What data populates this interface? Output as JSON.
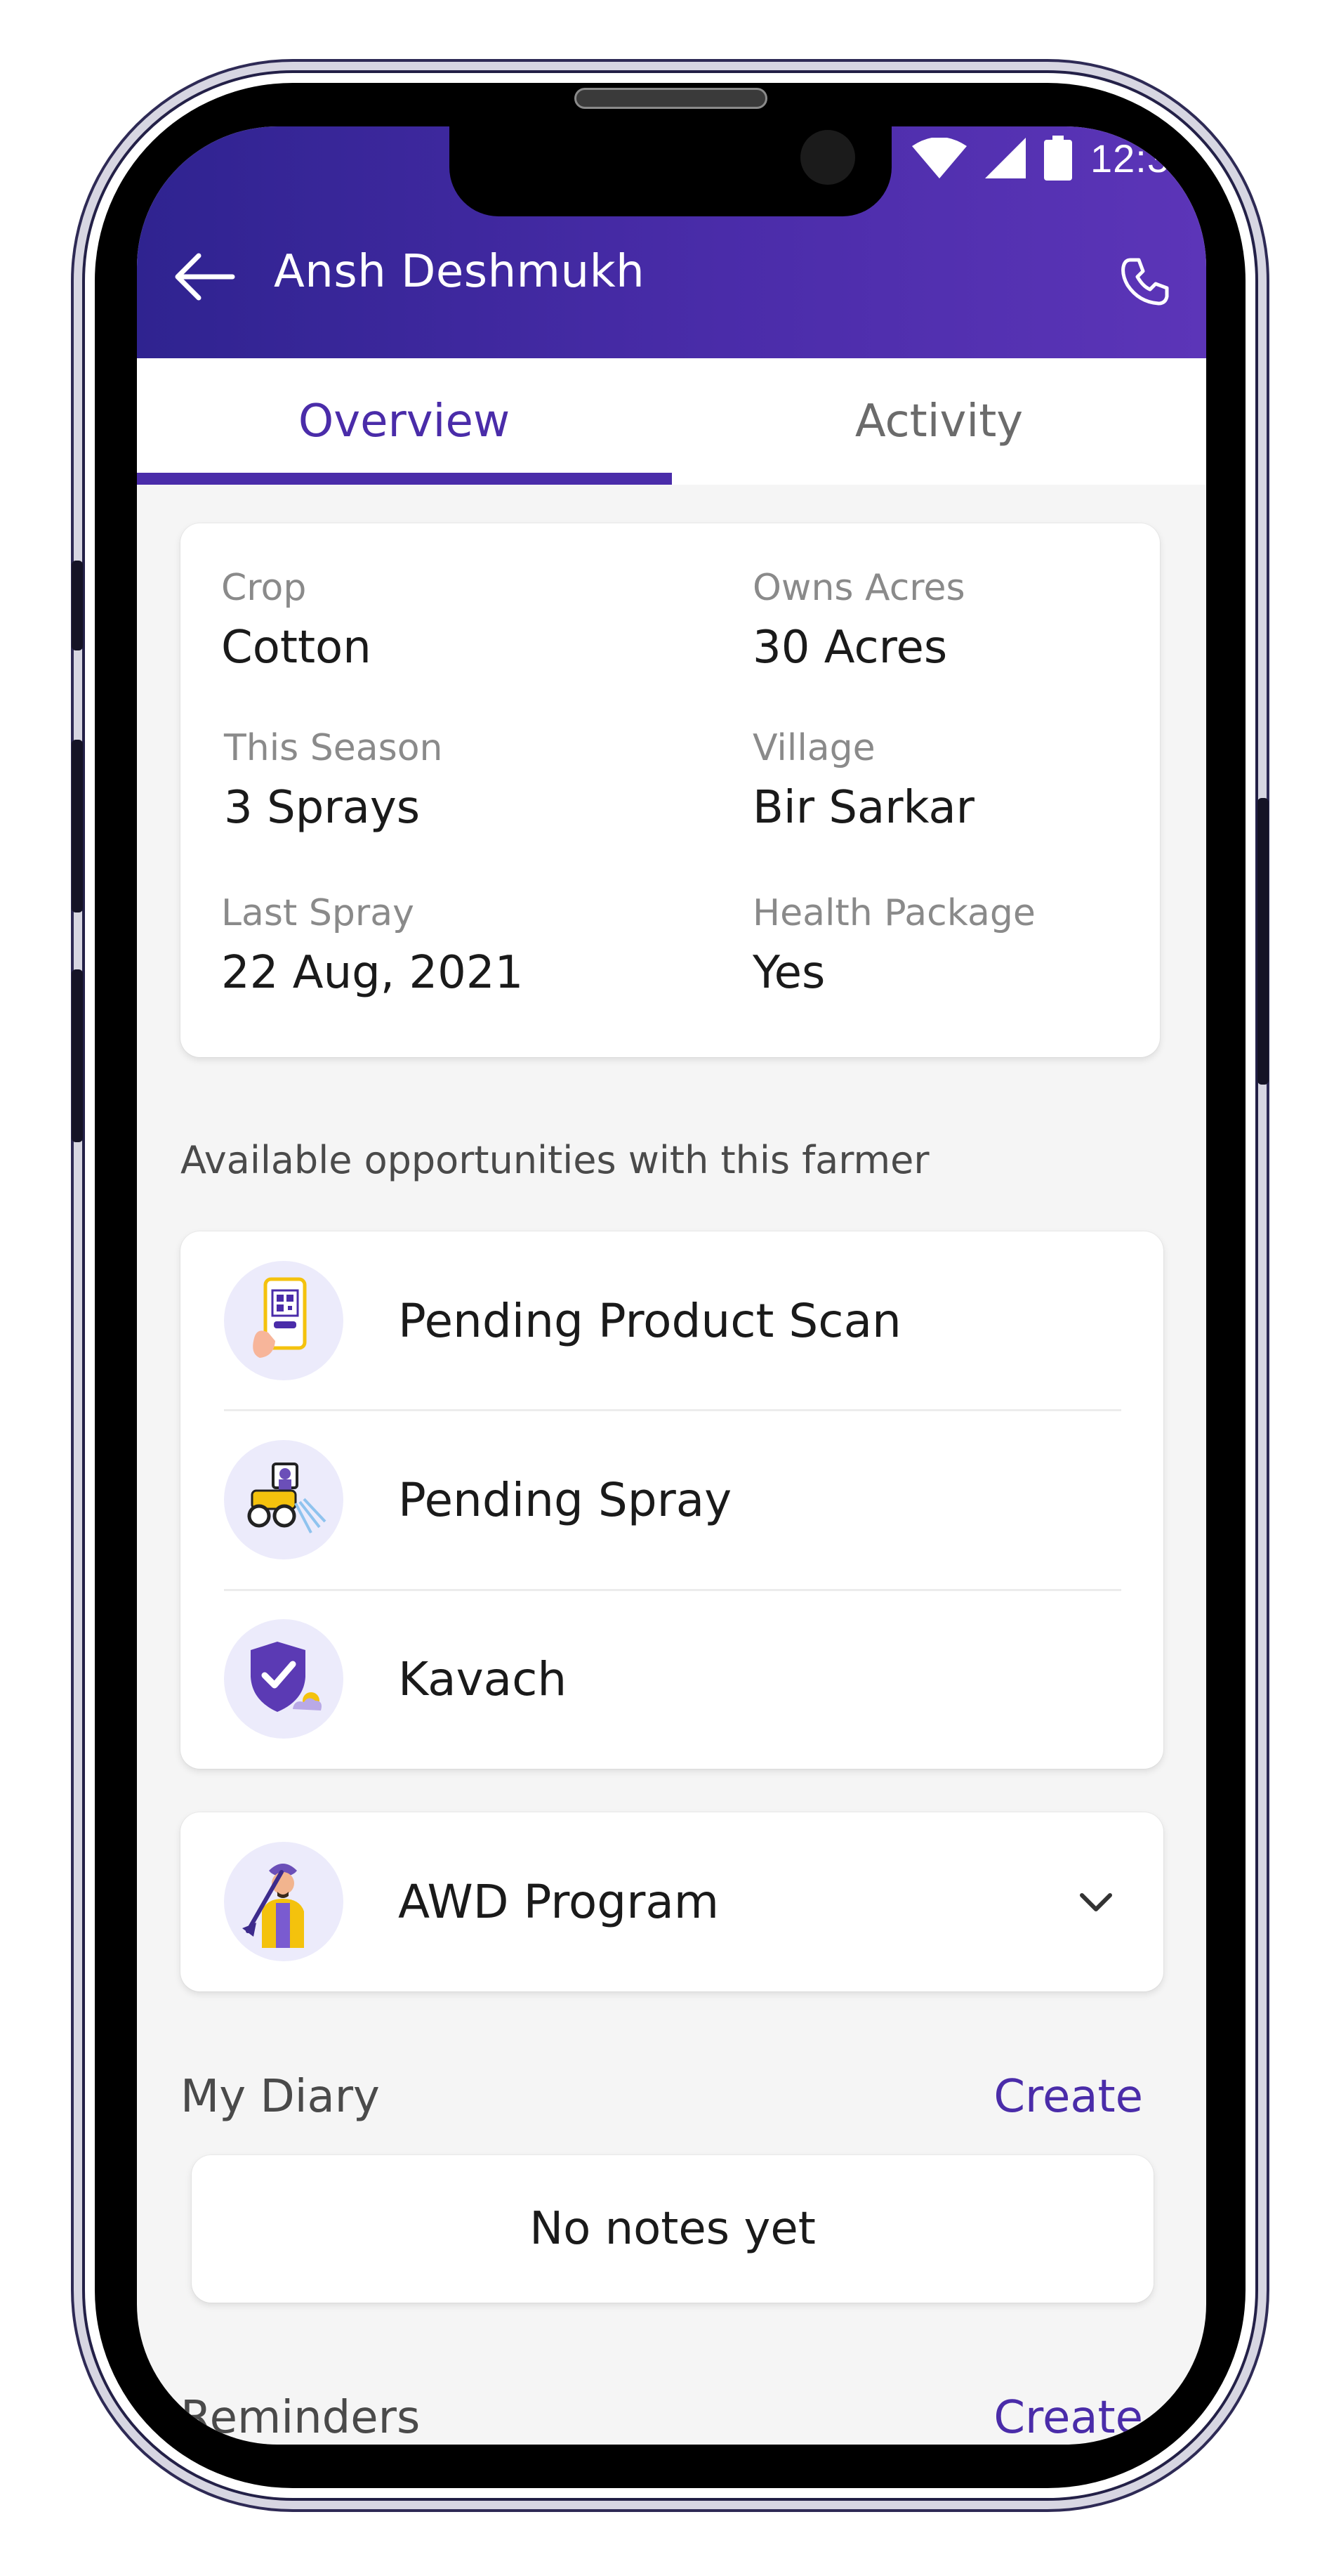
{
  "status_bar": {
    "time": "12:3"
  },
  "header": {
    "title": "Ansh Deshmukh",
    "back_icon": "arrow-left-icon",
    "call_icon": "phone-icon",
    "gradient": [
      "#2f2390",
      "#5c35b8"
    ]
  },
  "tabs": [
    {
      "label": "Overview",
      "active": true
    },
    {
      "label": "Activity",
      "active": false
    }
  ],
  "farmer_info": {
    "crop": {
      "label": "Crop",
      "value": "Cotton"
    },
    "owns_acres": {
      "label": "Owns Acres",
      "value": "30 Acres"
    },
    "this_season": {
      "label": "This Season",
      "value": "3 Sprays"
    },
    "village": {
      "label": "Village",
      "value": "Bir Sarkar"
    },
    "last_spray": {
      "label": "Last Spray",
      "value": "22 Aug, 2021"
    },
    "health_package": {
      "label": "Health Package",
      "value": "Yes"
    }
  },
  "opportunities": {
    "title": "Available opportunities with this farmer",
    "items": [
      {
        "label": "Pending Product Scan",
        "icon": "qr-scan-icon"
      },
      {
        "label": "Pending Spray",
        "icon": "spray-cart-icon"
      },
      {
        "label": "Kavach",
        "icon": "shield-check-icon"
      }
    ]
  },
  "awd": {
    "label": "AWD Program",
    "icon": "farmer-icon",
    "chevron": "chevron-down-icon"
  },
  "diary": {
    "title": "My Diary",
    "create": "Create",
    "empty": "No notes yet"
  },
  "reminders": {
    "title": "Reminders",
    "create": "Create"
  },
  "colors": {
    "accent": "#4a2ca9",
    "background": "#f5f5f5",
    "icon_bg": "#ecebfb"
  }
}
